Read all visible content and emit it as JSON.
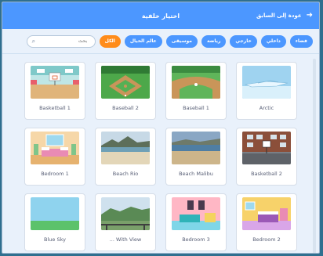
{
  "topbar": {
    "title": "اختيار خلفية",
    "back_label": "عودة إلى السابق"
  },
  "filters": {
    "categories": [
      "الكل",
      "عالم الخيال",
      "موسيقى",
      "رياضة",
      "خارجي",
      "داخلي",
      "فضاء"
    ],
    "active": "الكل",
    "search_placeholder": "بحث"
  },
  "backdrops": [
    {
      "name": "Basketball 1"
    },
    {
      "name": "Baseball 2"
    },
    {
      "name": "Baseball 1"
    },
    {
      "name": "Arctic"
    },
    {
      "name": "Bedroom 1"
    },
    {
      "name": "Beach Rio"
    },
    {
      "name": "Beach Malibu"
    },
    {
      "name": "Basketball 2"
    },
    {
      "name": "Blue Sky"
    },
    {
      "name": "... With View"
    },
    {
      "name": "Bedroom 3"
    },
    {
      "name": "Bedroom 2"
    }
  ],
  "colors": {
    "accent": "#4c97ff",
    "active_filter": "#ff8c1a"
  }
}
